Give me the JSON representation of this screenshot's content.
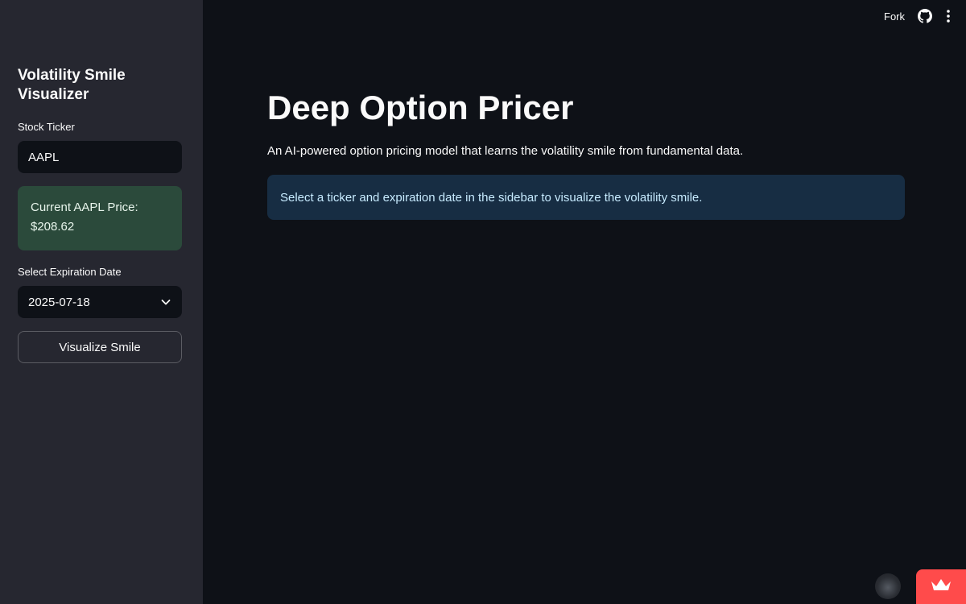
{
  "sidebar": {
    "title": "Volatility Smile Visualizer",
    "ticker_label": "Stock Ticker",
    "ticker_value": "AAPL",
    "price_label": "Current AAPL Price:",
    "price_value": "$208.62",
    "expiry_label": "Select Expiration Date",
    "expiry_value": "2025-07-18",
    "button_label": "Visualize Smile"
  },
  "toolbar": {
    "fork_label": "Fork",
    "icons": [
      "github-icon",
      "menu-icon"
    ]
  },
  "main": {
    "title": "Deep Option Pricer",
    "description": "An AI-powered option pricing model that learns the volatility smile from fundamental data.",
    "info_message": "Select a ticker and expiration date in the sidebar to visualize the volatility smile."
  },
  "colors": {
    "background": "#0e1117",
    "sidebar": "#262730",
    "success_box": "#2b4a3b",
    "info_box": "#172d43",
    "info_text": "#c7ebff",
    "brand": "#ff4b4b"
  }
}
